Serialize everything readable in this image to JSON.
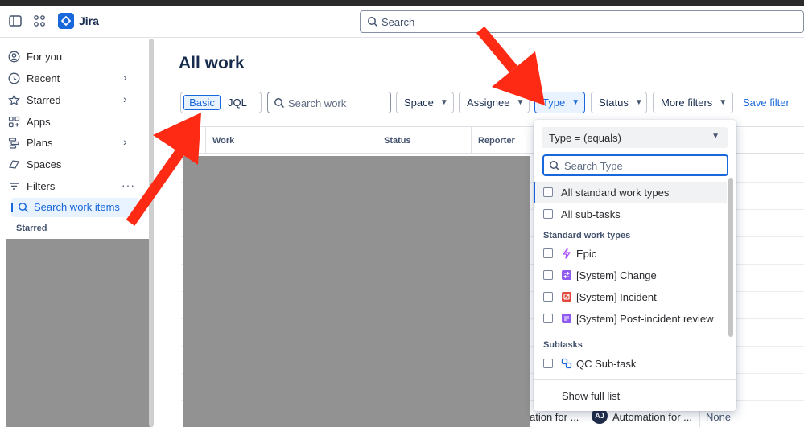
{
  "topbar": {
    "app_name": "Jira",
    "search_placeholder": "Search"
  },
  "sidebar": {
    "items": [
      {
        "label": "For you"
      },
      {
        "label": "Recent"
      },
      {
        "label": "Starred"
      },
      {
        "label": "Apps"
      },
      {
        "label": "Plans"
      },
      {
        "label": "Spaces"
      },
      {
        "label": "Filters"
      }
    ],
    "active_item": "Search work items",
    "starred_heading": "Starred"
  },
  "main": {
    "title": "All work",
    "toggle": {
      "basic": "Basic",
      "jql": "JQL"
    },
    "search_placeholder": "Search work",
    "filters": {
      "space": "Space",
      "assignee": "Assignee",
      "type": "Type",
      "status": "Status",
      "more": "More filters"
    },
    "save_filter": "Save filter",
    "table": {
      "headers": [
        "Work",
        "Status",
        "Reporter"
      ],
      "bottom_row": {
        "col1": "ation for ...",
        "avatar": "AJ",
        "col2": "Automation for ...",
        "col3": "None"
      }
    }
  },
  "dropdown": {
    "operator": "Type = (equals)",
    "search_placeholder": "Search Type",
    "top_items": [
      "All standard work types",
      "All sub-tasks"
    ],
    "standard_heading": "Standard work types",
    "standard_items": [
      {
        "label": "Epic",
        "icon": "epic-icon",
        "color": "#a54cff"
      },
      {
        "label": "[System] Change",
        "icon": "change-icon",
        "color": "#8f5af0"
      },
      {
        "label": "[System] Incident",
        "icon": "incident-icon",
        "color": "#e2483d"
      },
      {
        "label": "[System] Post-incident review",
        "icon": "post-incident-review-icon",
        "color": "#8f5af0"
      }
    ],
    "subtasks_heading": "Subtasks",
    "subtask_items": [
      {
        "label": "QC Sub-task",
        "icon": "subtask-icon",
        "color": "#1868db"
      }
    ],
    "footer": "Show full list"
  },
  "colors": {
    "accent": "#1868db",
    "annotation_arrow": "#ff2a13",
    "redaction": "#929292"
  }
}
